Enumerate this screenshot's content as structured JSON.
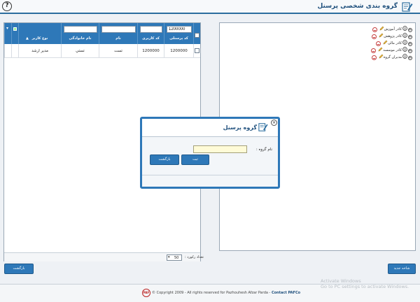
{
  "header": {
    "title": "گروه بندی شخصی پرسنل",
    "help_icon": "question-circle-icon",
    "title_icon": "pencil-document-icon"
  },
  "grid": {
    "columns": [
      {
        "key": "personnel_code",
        "label": "کد پرسنلی",
        "filter_value": "1200000"
      },
      {
        "key": "user_code",
        "label": "کد کاربری",
        "filter_value": ""
      },
      {
        "key": "first_name",
        "label": "نام",
        "filter_value": ""
      },
      {
        "key": "last_name",
        "label": "نام خانوادگی",
        "filter_value": ""
      },
      {
        "key": "user_type",
        "label": "نوع کاربر",
        "filter_value": ""
      }
    ],
    "rows": [
      {
        "personnel_code": "1200000",
        "user_code": "1200000",
        "first_name": "تست",
        "last_name": "تستي",
        "user_type": "مدیر ارشد"
      }
    ],
    "pager_label": "تعداد رکورد :",
    "page_size": "50"
  },
  "tree": {
    "items": [
      {
        "label": "کادر آموزش"
      },
      {
        "label": "کادر پژوهش"
      },
      {
        "label": "کادر مالی"
      },
      {
        "label": "کادر موسسه"
      },
      {
        "label": "مدیران گروه"
      }
    ]
  },
  "buttons": {
    "back": "بازگشت",
    "new_branch": "شاخه جدید"
  },
  "modal": {
    "title": "گروه پرسنل",
    "field_label": "نام گروه :",
    "field_value": "",
    "submit": "ثبت",
    "back": "بازگشت"
  },
  "footer": {
    "copyright": "© Copyright 2009 - All rights reserved for Pazhouhesh Afzar Parda - ",
    "contact": "Contact PAFCo",
    "logo_text": "PAF"
  },
  "watermark": {
    "line1": "Activate Windows",
    "line2": "Go to PC settings to activate Windows."
  },
  "colors": {
    "accent": "#2e78b8",
    "title": "#1e4f7c",
    "delete": "#c43b3b",
    "input_bg": "#fffbd7"
  }
}
